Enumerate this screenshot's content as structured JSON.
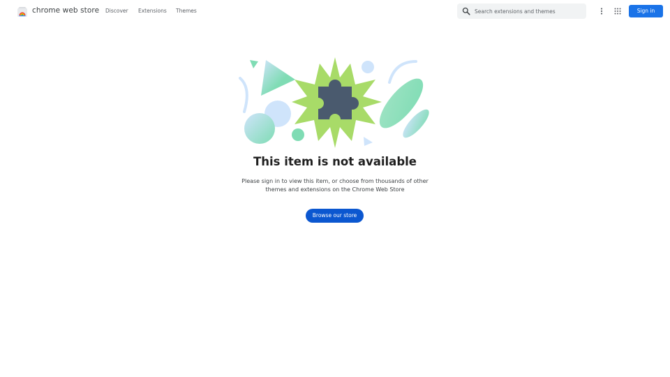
{
  "header": {
    "brand": "chrome web store",
    "nav": [
      {
        "label": "Discover"
      },
      {
        "label": "Extensions"
      },
      {
        "label": "Themes"
      }
    ],
    "search": {
      "placeholder": "Search extensions and themes",
      "value": ""
    },
    "sign_in_label": "Sign in",
    "icons": {
      "logo": "chrome-web-store-logo",
      "search": "search-icon",
      "more": "more-vert-icon",
      "apps": "apps-grid-icon"
    }
  },
  "main": {
    "title": "This item is not available",
    "subtitle": "Please sign in to view this item, or choose from thousands of other themes and extensions on the Chrome Web Store",
    "browse_label": "Browse our store",
    "illustration": "puzzle-piece-illustration"
  },
  "colors": {
    "primary_blue": "#1a73e8",
    "button_blue": "#0b57d0",
    "burst_green": "#a8db68",
    "puzzle": "#4a5a6e",
    "mint": "#7fdcb4",
    "light_blue": "#cfe4fb"
  }
}
